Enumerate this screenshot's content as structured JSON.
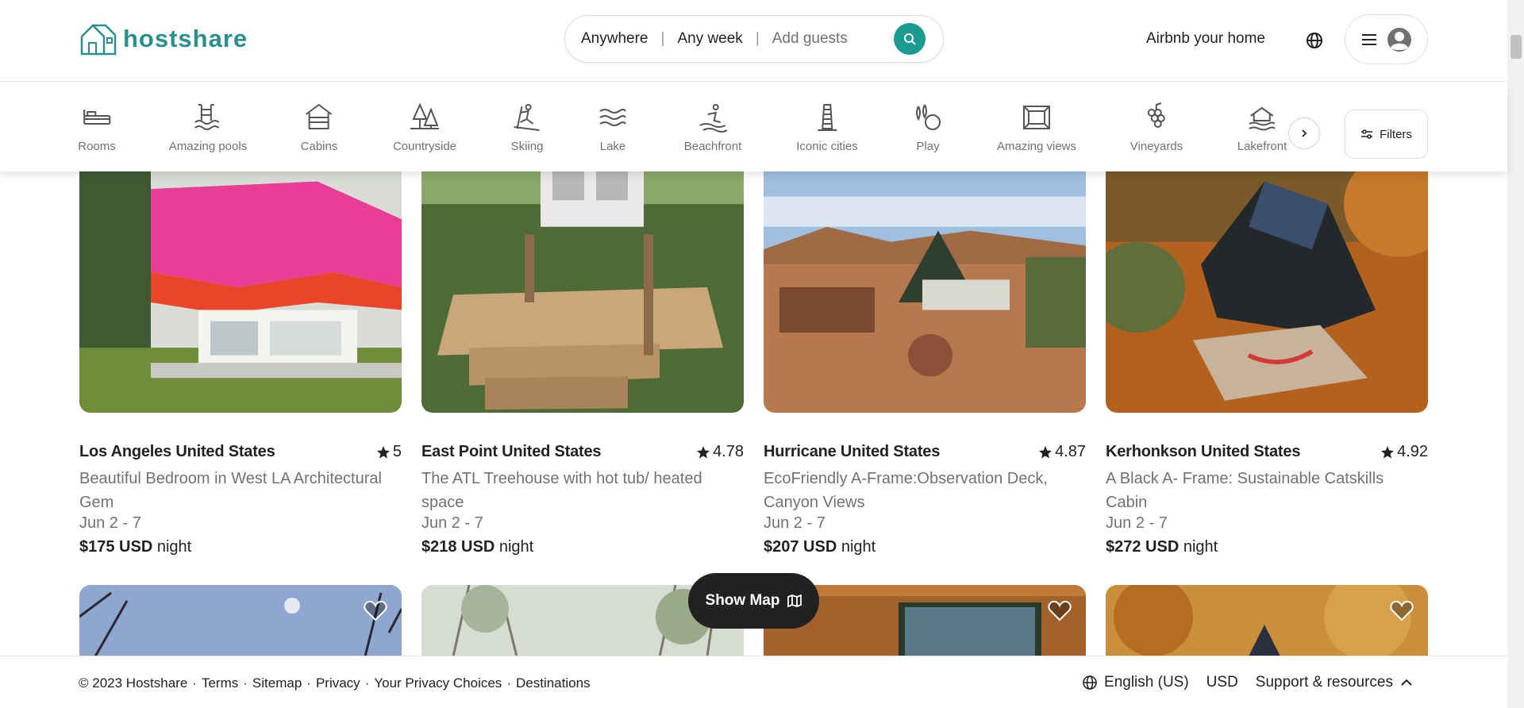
{
  "brand": {
    "name": "hostshare",
    "accent": "#2a8f8f"
  },
  "search": {
    "location": "Anywhere",
    "week": "Any week",
    "guests": "Add guests"
  },
  "header": {
    "host_link": "Airbnb your home"
  },
  "categories": [
    {
      "label": "Rooms",
      "icon": "bed-icon"
    },
    {
      "label": "Amazing pools",
      "icon": "pool-icon"
    },
    {
      "label": "Cabins",
      "icon": "cabin-icon"
    },
    {
      "label": "Countryside",
      "icon": "trees-icon"
    },
    {
      "label": "Skiing",
      "icon": "skiing-icon"
    },
    {
      "label": "Lake",
      "icon": "waves-icon"
    },
    {
      "label": "Beachfront",
      "icon": "surfer-icon"
    },
    {
      "label": "Iconic cities",
      "icon": "tower-icon"
    },
    {
      "label": "Play",
      "icon": "bowling-icon"
    },
    {
      "label": "Amazing views",
      "icon": "frame-icon"
    },
    {
      "label": "Vineyards",
      "icon": "grapes-icon"
    },
    {
      "label": "Lakefront",
      "icon": "lakehouse-icon"
    }
  ],
  "filters_label": "Filters",
  "listings": [
    {
      "location": "Los Angeles United States",
      "rating": "5",
      "description": "Beautiful Bedroom in West LA Architectural Gem",
      "dates": "Jun 2 - 7",
      "price": "$175 USD",
      "unit": "night"
    },
    {
      "location": "East Point United States",
      "rating": "4.78",
      "description": "The ATL Treehouse with hot tub/ heated space",
      "dates": "Jun 2 - 7",
      "price": "$218 USD",
      "unit": "night"
    },
    {
      "location": "Hurricane United States",
      "rating": "4.87",
      "description": "EcoFriendly A-Frame:Observation Deck, Canyon Views",
      "dates": "Jun 2 - 7",
      "price": "$207 USD",
      "unit": "night"
    },
    {
      "location": "Kerhonkson United States",
      "rating": "4.92",
      "description": "A Black A- Frame: Sustainable Catskills Cabin",
      "dates": "Jun 2 - 7",
      "price": "$272 USD",
      "unit": "night"
    }
  ],
  "show_map": "Show Map",
  "footer": {
    "copyright": "© 2023 Hostshare",
    "links": [
      "Terms",
      "Sitemap",
      "Privacy",
      "Your Privacy Choices",
      "Destinations"
    ],
    "language": "English (US)",
    "currency": "USD",
    "support": "Support & resources"
  }
}
